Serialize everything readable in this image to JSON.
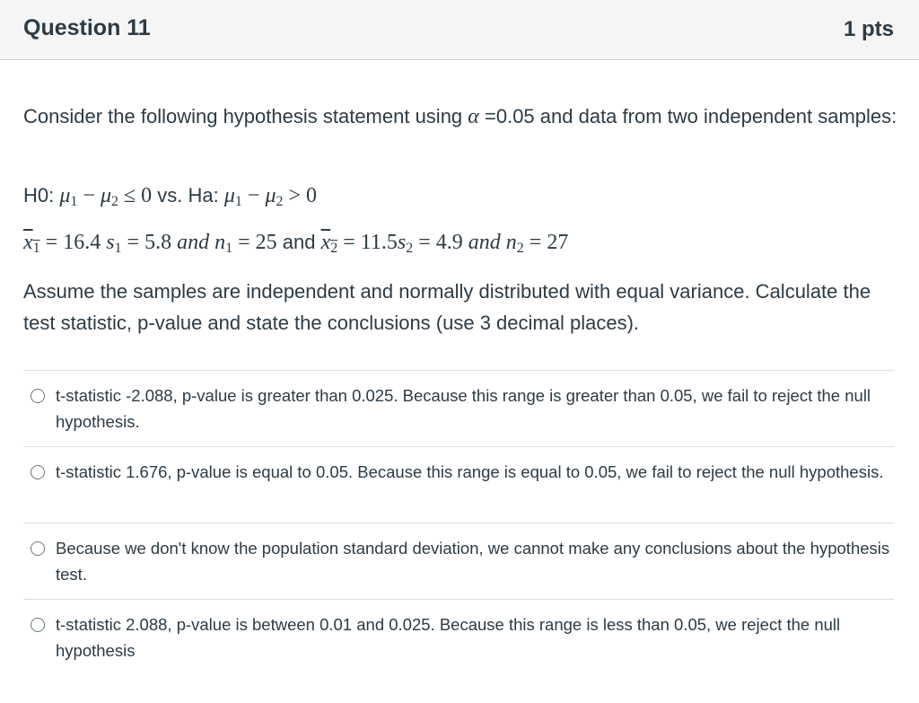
{
  "header": {
    "title": "Question 11",
    "points": "1 pts"
  },
  "question": {
    "intro_before_alpha": "Consider the following hypothesis statement using ",
    "alpha_symbol": "α",
    "intro_after_alpha": " =0.05 and data from two independent samples:",
    "h0_label": "H0: ",
    "mu1": "μ",
    "sub1": "1",
    "minus": " − ",
    "mu2": "μ",
    "sub2": "2",
    "h0_relation": " ≤ 0",
    "vs_ha": " vs. Ha: ",
    "ha_relation": " > 0",
    "x1bar": "x",
    "x1_sub": "1",
    "x1_value": " = 16.4 ",
    "s1": "s",
    "s1_sub": "1",
    "s1_value": " = 5.8 ",
    "and1": "and ",
    "n1": "n",
    "n1_sub": "1",
    "n1_value": " = 25",
    "and_text": " and ",
    "x2bar": "x",
    "x2_sub": "2",
    "x2_value": " = 11.5",
    "s2": "s",
    "s2_sub": "2",
    "s2_value": " = 4.9 ",
    "and2": "and ",
    "n2": "n",
    "n2_sub": "2",
    "n2_value": " = 27",
    "instructions": "Assume the samples are independent and normally distributed with equal variance. Calculate the test statistic, p-value and state the conclusions (use 3 decimal places)."
  },
  "answers": [
    {
      "text": "t-statistic -2.088, p-value is greater than 0.025. Because this range is greater than 0.05, we fail to reject the null hypothesis."
    },
    {
      "text": "t-statistic 1.676, p-value is equal to  0.05. Because this range is equal to 0.05, we fail to reject the null hypothesis."
    },
    {
      "text": "Because we don't know the population standard deviation, we cannot make any conclusions about the hypothesis test."
    },
    {
      "text": "t-statistic 2.088, p-value is between 0.01 and 0.025. Because this range is less than 0.05, we reject the null hypothesis"
    }
  ]
}
